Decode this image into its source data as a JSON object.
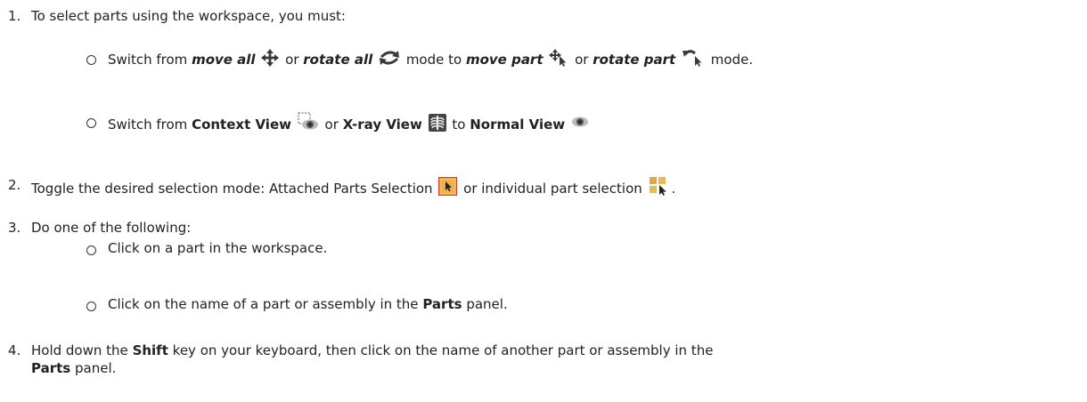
{
  "steps": [
    {
      "number": "1.",
      "text": "To select parts using the workspace, you must:",
      "bullets": [
        {
          "switch_from": "Switch from",
          "move_all": "move all",
          "or": "or",
          "rotate_all": "rotate all",
          "mode_to": "mode to",
          "move_part": "move part",
          "rotate_part": "rotate part",
          "mode_end": "mode."
        },
        {
          "switch_from": "Switch from",
          "context_view": "Context View",
          "or": "or",
          "xray_view": "X-ray View",
          "to": "to",
          "normal_view": "Normal View"
        }
      ]
    },
    {
      "number": "2.",
      "text_before": "Toggle the desired selection mode: Attached Parts Selection",
      "or": "or individual part selection",
      "period": "."
    },
    {
      "number": "3.",
      "text": "Do one of the following:",
      "bullets": [
        {
          "text": "Click on a part in the workspace."
        },
        {
          "before": "Click on the name of a part or assembly in the",
          "bold": "Parts",
          "after": "panel."
        }
      ]
    },
    {
      "number": "4.",
      "before": "Hold down the",
      "shift": "Shift",
      "after": "key on your keyboard, then click on the name of another part or assembly in the",
      "parts": "Parts",
      "panel": "panel."
    }
  ],
  "icons": {
    "move_all": "move-all-icon",
    "rotate_all": "rotate-all-icon",
    "move_part": "move-part-icon",
    "rotate_part": "rotate-part-icon",
    "context_view": "context-view-icon",
    "xray_view": "xray-view-icon",
    "normal_view": "normal-view-icon",
    "attached_parts_selection": "attached-parts-selection-icon",
    "individual_part_selection": "individual-part-selection-icon"
  }
}
